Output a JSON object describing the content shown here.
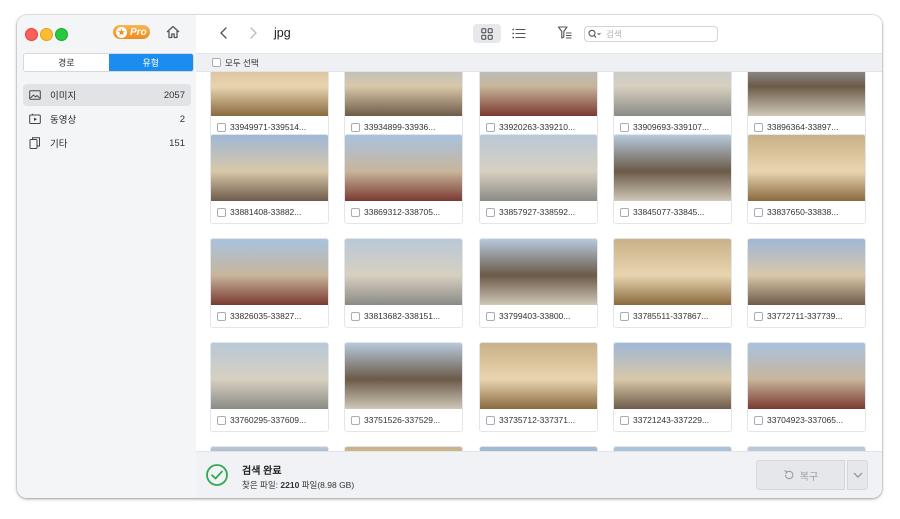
{
  "sidebar": {
    "pro_label": "Pro",
    "segments": [
      {
        "label": "경로",
        "active": false
      },
      {
        "label": "유형",
        "active": true
      }
    ],
    "items": [
      {
        "label": "이미지",
        "count": "2057",
        "icon": "image-icon",
        "selected": true
      },
      {
        "label": "동영상",
        "count": "2",
        "icon": "video-icon",
        "selected": false
      },
      {
        "label": "기타",
        "count": "151",
        "icon": "file-icon",
        "selected": false
      }
    ]
  },
  "toolbar": {
    "folder_title": "jpg",
    "search_placeholder": "검색",
    "view_mode": "grid"
  },
  "select_all_label": "모두 선택",
  "files": [
    [
      "33949971-339514...",
      "33934899-33936...",
      "33920263-339210...",
      "33909693-339107...",
      "33896364-33897..."
    ],
    [
      "33881408-33882...",
      "33869312-338705...",
      "33857927-338592...",
      "33845077-33845...",
      "33837650-33838..."
    ],
    [
      "33826035-33827...",
      "33813682-338151...",
      "33799403-33800...",
      "33785511-337867...",
      "33772711-337739..."
    ],
    [
      "33760295-337609...",
      "33751526-337529...",
      "33735712-337371...",
      "33721243-337229...",
      "33704923-337065..."
    ]
  ],
  "status": {
    "title": "검색 완료",
    "found_prefix": "찾은 파일:",
    "found_count": "2210",
    "found_suffix": "파일(8.98 GB)"
  },
  "recover_label": "복구",
  "colors": {
    "accent": "#1b8df0",
    "success": "#34a853",
    "pro_badge": "#f28a1c"
  }
}
